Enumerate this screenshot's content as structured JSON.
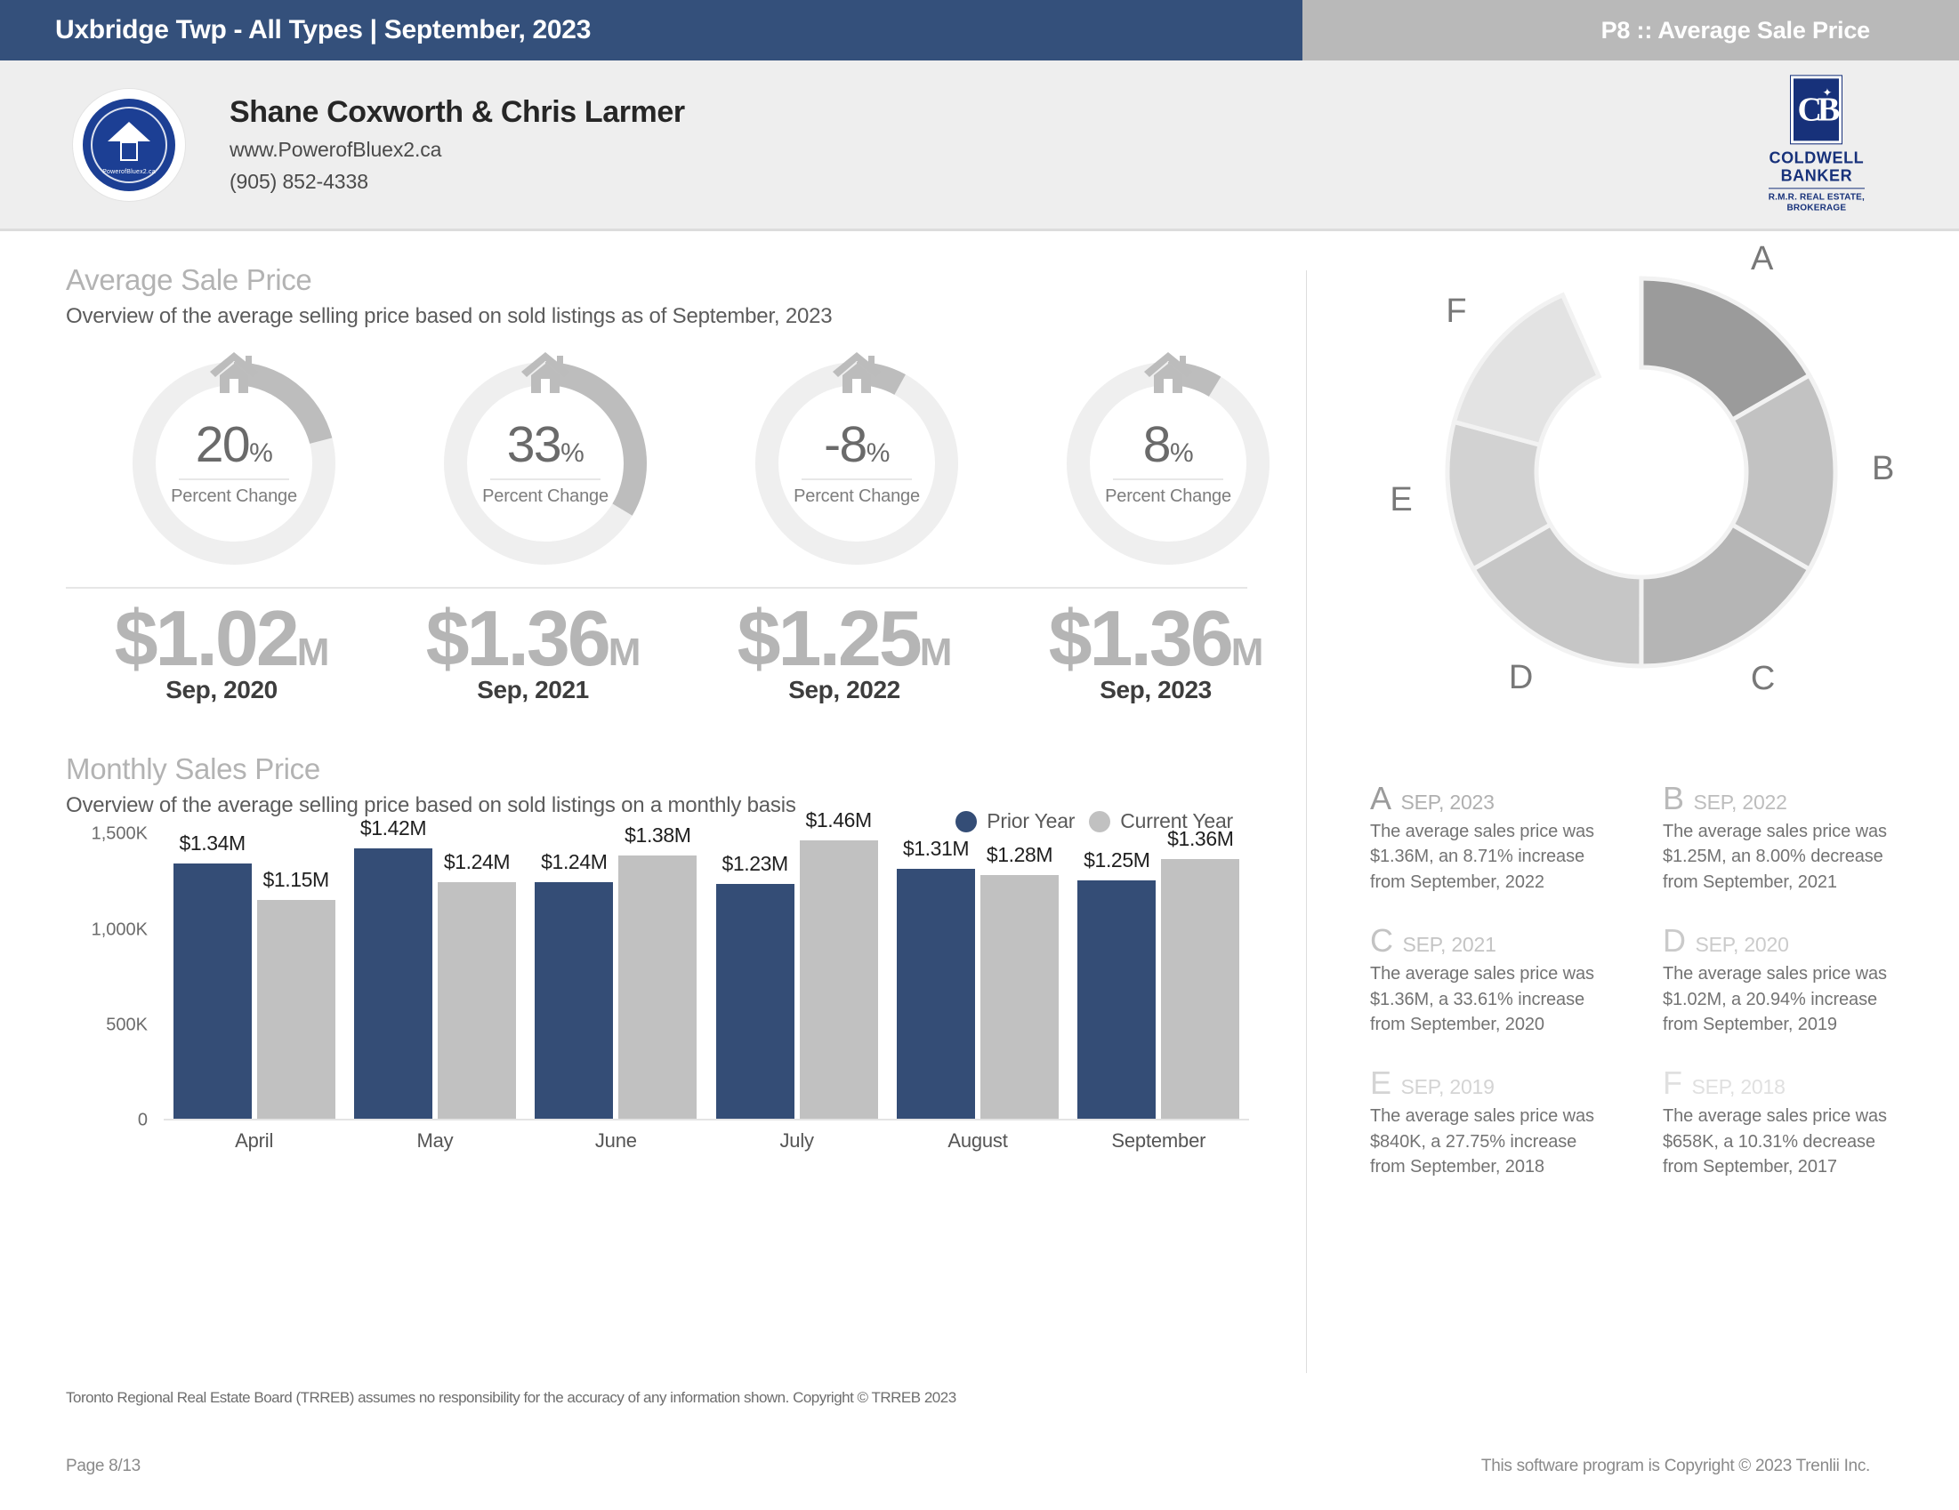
{
  "header": {
    "title": "Uxbridge Twp - All Types | September, 2023",
    "page_label": "P8 :: Average Sale Price",
    "bar_color": "#34507b",
    "right_bar_color": "#b9b9b9"
  },
  "agent": {
    "name": "Shane Coxworth & Chris Larmer",
    "website": "www.PowerofBluex2.ca",
    "phone": "(905) 852-4338",
    "seal_text": "PowerofBluex2.ca",
    "brokerage": {
      "mark": "CB",
      "name_line1": "COLDWELL",
      "name_line2": "BANKER",
      "sub_line1": "R.M.R. REAL ESTATE,",
      "sub_line2": "BROKERAGE",
      "color": "#17317a"
    }
  },
  "average_sale_price": {
    "title": "Average Sale Price",
    "subtitle": "Overview of the average selling price based on sold listings as of September, 2023",
    "gauges": [
      {
        "value": "20",
        "pct_symbol": "%",
        "caption": "Percent Change",
        "arc_fraction": 0.2094
      },
      {
        "value": "33",
        "pct_symbol": "%",
        "caption": "Percent Change",
        "arc_fraction": 0.3361
      },
      {
        "value": "-8",
        "pct_symbol": "%",
        "caption": "Percent Change",
        "arc_fraction": 0.08
      },
      {
        "value": "8",
        "pct_symbol": "%",
        "caption": "Percent Change",
        "arc_fraction": 0.0871
      }
    ],
    "prices": [
      {
        "amount": "$1.02",
        "unit": "M",
        "label": "Sep, 2020"
      },
      {
        "amount": "$1.36",
        "unit": "M",
        "label": "Sep, 2021"
      },
      {
        "amount": "$1.25",
        "unit": "M",
        "label": "Sep, 2022"
      },
      {
        "amount": "$1.36",
        "unit": "M",
        "label": "Sep, 2023"
      }
    ]
  },
  "monthly": {
    "title": "Monthly Sales Price",
    "subtitle": "Overview of the average selling price based on sold listings on a monthly basis"
  },
  "chart_data": {
    "type": "bar",
    "title": "Monthly Sales Price",
    "xlabel": "",
    "ylabel": "",
    "ylim": [
      0,
      1500
    ],
    "yticks": [
      "0",
      "500K",
      "1,000K",
      "1,500K"
    ],
    "ytick_values": [
      0,
      500,
      1000,
      1500
    ],
    "grid": false,
    "legend_position": "top-right",
    "categories": [
      "April",
      "May",
      "June",
      "July",
      "August",
      "September"
    ],
    "series": [
      {
        "name": "Prior Year",
        "color": "#344d76",
        "values": [
          1340,
          1420,
          1240,
          1230,
          1310,
          1250
        ],
        "labels": [
          "$1.34M",
          "$1.42M",
          "$1.24M",
          "$1.23M",
          "$1.31M",
          "$1.25M"
        ]
      },
      {
        "name": "Current Year",
        "color": "#c1c1c1",
        "values": [
          1150,
          1240,
          1380,
          1460,
          1280,
          1360
        ],
        "labels": [
          "$1.15M",
          "$1.24M",
          "$1.38M",
          "$1.46M",
          "$1.28M",
          "$1.36M"
        ]
      }
    ]
  },
  "donut": {
    "type": "pie",
    "labels": [
      "A",
      "B",
      "C",
      "D",
      "E",
      "F"
    ],
    "slices": [
      {
        "label": "A",
        "fraction": 0.1667,
        "color": "#9b9b9b"
      },
      {
        "label": "B",
        "fraction": 0.1667,
        "color": "#c2c2c2"
      },
      {
        "label": "C",
        "fraction": 0.1667,
        "color": "#b5b5b5"
      },
      {
        "label": "D",
        "fraction": 0.1667,
        "color": "#c6c6c6"
      },
      {
        "label": "E",
        "fraction": 0.125,
        "color": "#d2d2d2"
      },
      {
        "label": "F",
        "fraction": 0.1417,
        "color": "#e3e3e3"
      }
    ]
  },
  "legend_blocks": [
    {
      "letter": "A",
      "date": "SEP, 2023",
      "body": "The average sales price was $1.36M, an 8.71% increase from September, 2022",
      "letter_color": "#9b9b9b",
      "date_color": "#b0b0b0"
    },
    {
      "letter": "B",
      "date": "SEP, 2022",
      "body": "The average sales price was $1.25M, an 8.00% decrease from September, 2021",
      "letter_color": "#b9b9b9",
      "date_color": "#bdbdbd"
    },
    {
      "letter": "C",
      "date": "SEP, 2021",
      "body": "The average sales price was $1.36M, a 33.61% increase from September, 2020",
      "letter_color": "#c3c3c3",
      "date_color": "#c4c4c4"
    },
    {
      "letter": "D",
      "date": "SEP, 2020",
      "body": "The average sales price was $1.02M, a 20.94% increase from September, 2019",
      "letter_color": "#cacaca",
      "date_color": "#cbcbcb"
    },
    {
      "letter": "E",
      "date": "SEP, 2019",
      "body": "The average sales price was $840K, a 27.75% increase from September, 2018",
      "letter_color": "#d4d4d4",
      "date_color": "#d4d4d4"
    },
    {
      "letter": "F",
      "date": "SEP, 2018",
      "body": "The average sales price was $658K, a 10.31% decrease from September, 2017",
      "letter_color": "#e0e0e0",
      "date_color": "#e0e0e0"
    }
  ],
  "footer": {
    "disclaimer": "Toronto Regional Real Estate Board (TRREB) assumes no responsibility for the accuracy of any information shown. Copyright © TRREB 2023",
    "page": "Page 8/13",
    "copyright": "This software program is Copyright © 2023 Trenlii Inc."
  }
}
